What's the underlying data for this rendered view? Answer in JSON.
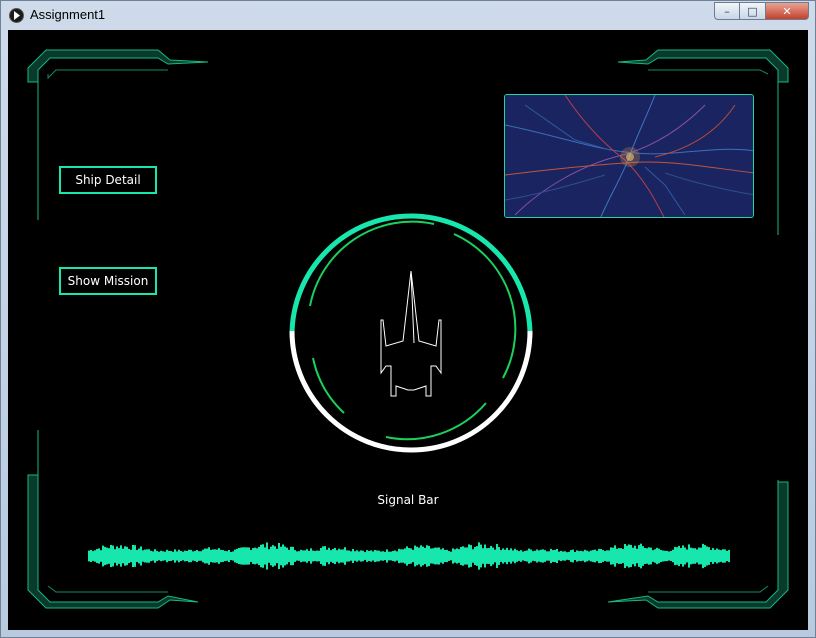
{
  "window": {
    "title": "Assignment1",
    "controls": {
      "minimize": "–",
      "maximize": "□",
      "close": "✕"
    }
  },
  "hud": {
    "buttons": {
      "ship_detail": "Ship Detail",
      "show_mission": "Show Mission"
    },
    "signal_bar_label": "Signal Bar"
  },
  "icons": {
    "app": "play-icon",
    "ship": "spaceship-icon",
    "map": "city-map-thumbnail"
  },
  "colors": {
    "accent": "#17e6ad",
    "radar_inner": "#18d25a",
    "frame": "#0f8a63",
    "background": "#000000",
    "text": "#ffffff"
  }
}
